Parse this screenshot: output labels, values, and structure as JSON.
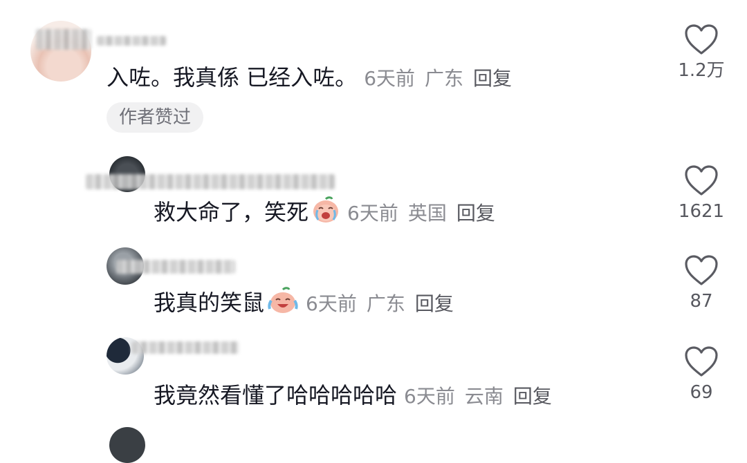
{
  "comments": [
    {
      "text": "入咗。我真係 已经入咗。",
      "time": "6天前",
      "location": "广东",
      "reply_label": "回复",
      "likes": "1.2万",
      "badge": "作者赞过"
    },
    {
      "text": "救大命了，笑死",
      "emoji": "crying-laughing-peach-emoji",
      "time": "6天前",
      "location": "英国",
      "reply_label": "回复",
      "likes": "1621"
    },
    {
      "text": "我真的笑鼠",
      "emoji": "laughing-tears-peach-emoji",
      "time": "6天前",
      "location": "广东",
      "reply_label": "回复",
      "likes": "87"
    },
    {
      "text": "我竟然看懂了哈哈哈哈哈",
      "time": "6天前",
      "location": "云南",
      "reply_label": "回复",
      "likes": "69"
    }
  ],
  "icons": {
    "like": "heart-outline-icon"
  },
  "colors": {
    "text": "#161823",
    "meta": "#8a8b91",
    "reply": "#57585f",
    "badge_bg": "#f1f1f2"
  }
}
